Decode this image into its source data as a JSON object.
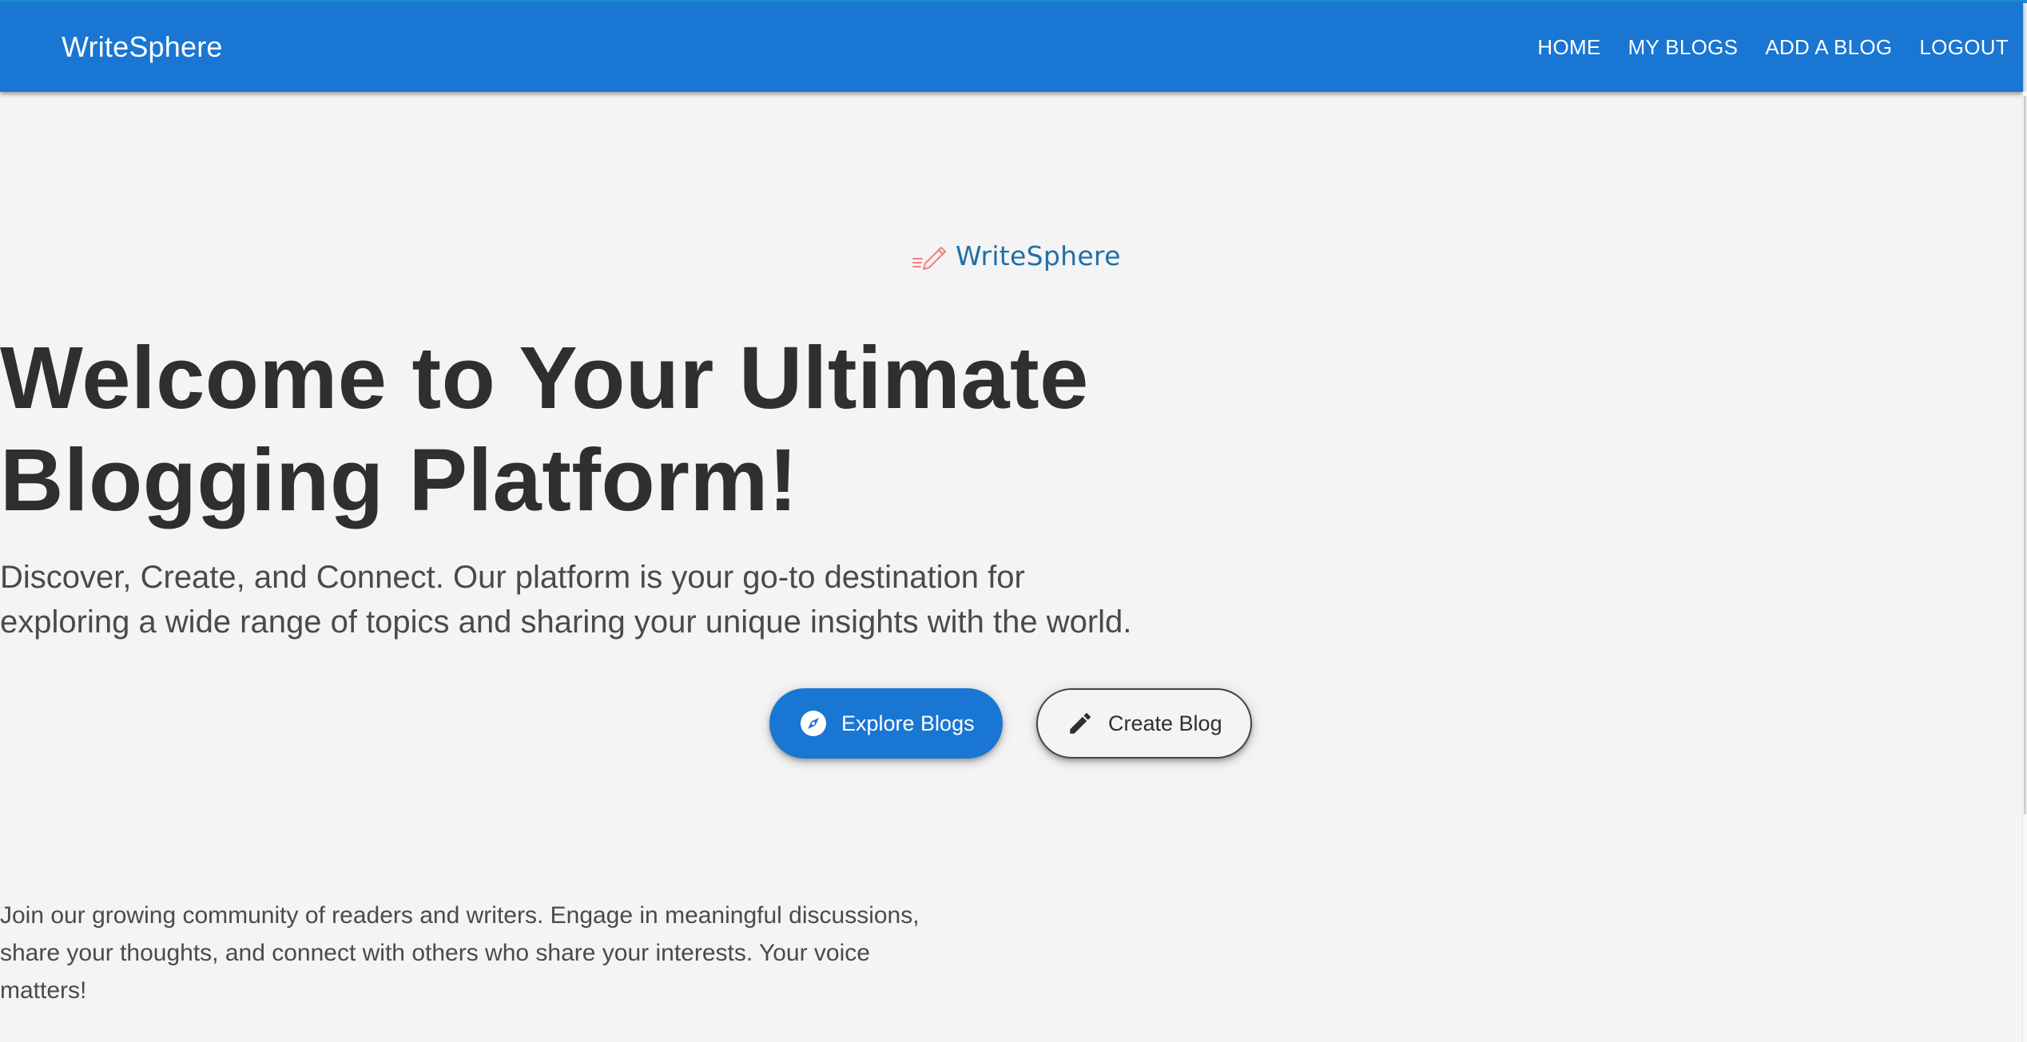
{
  "navbar": {
    "brand": "WriteSphere",
    "links": [
      {
        "label": "HOME"
      },
      {
        "label": "MY BLOGS"
      },
      {
        "label": "ADD A BLOG"
      },
      {
        "label": "LOGOUT"
      }
    ]
  },
  "hero": {
    "logo_icon": "pencil-writing-icon",
    "logo_text": "WriteSphere",
    "headline_lines": [
      "Welcome to Your Ultimate",
      "Blogging Platform!"
    ],
    "subtitle_lines": [
      "Discover, Create, and Connect. Our platform is your go-to destination for",
      "exploring a wide range of topics and sharing your unique insights with the world."
    ],
    "buttons": {
      "explore": {
        "label": "Explore Blogs",
        "icon": "compass-icon"
      },
      "create": {
        "label": "Create Blog",
        "icon": "pencil-icon"
      }
    },
    "community_lines": [
      "Join our growing community of readers and writers. Engage in meaningful discussions,",
      "share your thoughts, and connect with others who share your interests. Your voice",
      "matters!"
    ]
  },
  "colors": {
    "primary": "#1976d2",
    "background": "#f4f4f4",
    "headline": "#2f2f2f",
    "body_text": "#4a4a4a",
    "logo_text": "#1e6fa8",
    "logo_icon": "#f08080"
  }
}
